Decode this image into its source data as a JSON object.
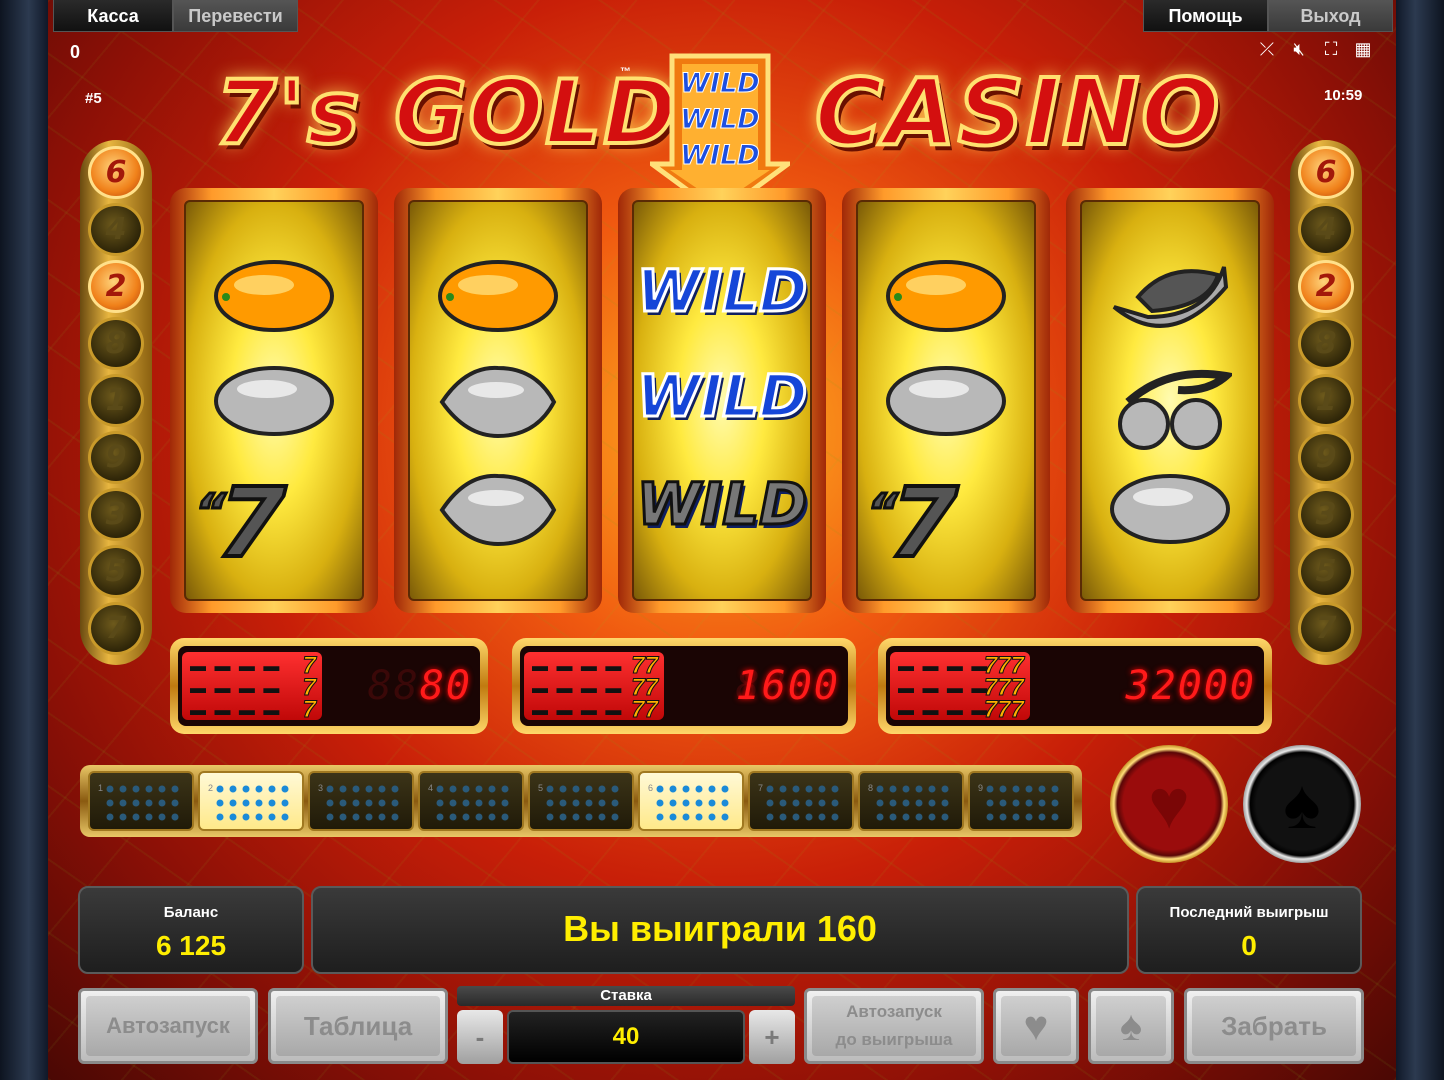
{
  "menu": {
    "cashier": "Касса",
    "transfer": "Перевести",
    "help": "Помощь",
    "exit": "Выход"
  },
  "top": {
    "counter": "0",
    "round": "#5",
    "clock": "10:59"
  },
  "icons": [
    "broken-link-icon",
    "mute-icon",
    "fullscreen-icon",
    "grid-icon"
  ],
  "logo": {
    "left": "7's GOLD",
    "right": "CASINO",
    "tm": "™",
    "arrow_words": [
      "WILD",
      "WILD",
      "WILD"
    ]
  },
  "lines_left": [
    "6",
    "4",
    "2",
    "8",
    "1",
    "9",
    "3",
    "5",
    "7"
  ],
  "lines_right": [
    "6",
    "4",
    "2",
    "8",
    "1",
    "9",
    "3",
    "5",
    "7"
  ],
  "active_lines": [
    "6",
    "2"
  ],
  "reels": [
    [
      "orange",
      "plum",
      "seven"
    ],
    [
      "orange",
      "lemon",
      "lemon"
    ],
    [
      "WILD",
      "WILD",
      "WILD"
    ],
    [
      "orange",
      "plum",
      "seven"
    ],
    [
      "watermelon",
      "cherry",
      "plum"
    ]
  ],
  "paytable": [
    {
      "symbols": "7",
      "value": "80"
    },
    {
      "symbols": "77",
      "value": "1600"
    },
    {
      "symbols": "777",
      "value": "32000"
    }
  ],
  "line_tiles": [
    {
      "n": "1",
      "on": false
    },
    {
      "n": "2",
      "on": true
    },
    {
      "n": "3",
      "on": false
    },
    {
      "n": "4",
      "on": false
    },
    {
      "n": "5",
      "on": false
    },
    {
      "n": "6",
      "on": true
    },
    {
      "n": "7",
      "on": false
    },
    {
      "n": "8",
      "on": false
    },
    {
      "n": "9",
      "on": false
    }
  ],
  "balance": {
    "label": "Баланс",
    "value": "6 125"
  },
  "message": "Вы выиграли 160",
  "last_win": {
    "label": "Последний выигрыш",
    "value": "0"
  },
  "buttons": {
    "autoplay": "Автозапуск",
    "table": "Таблица",
    "stake_label": "Ставка",
    "stake_value": "40",
    "minus": "-",
    "plus": "+",
    "autoplay_until_win_1": "Автозапуск",
    "autoplay_until_win_2": "до выигрыша",
    "take": "Забрать"
  }
}
